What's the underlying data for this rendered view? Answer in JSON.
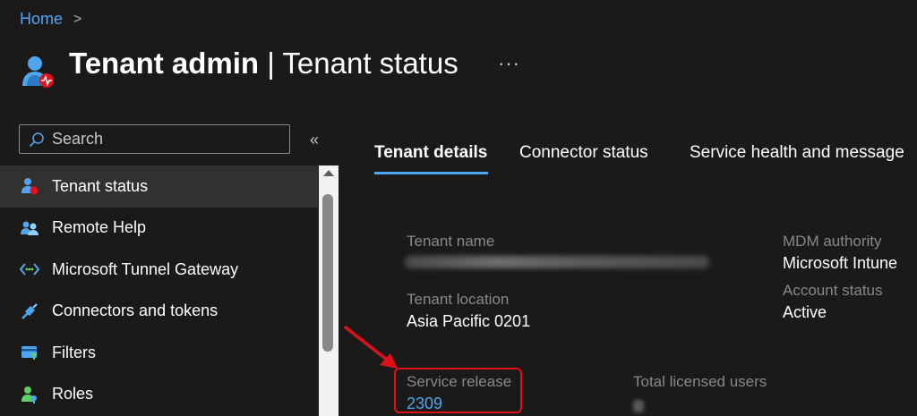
{
  "breadcrumb": {
    "home": "Home",
    "separator": ">"
  },
  "header": {
    "title_strong": "Tenant admin",
    "title_sep": " | ",
    "title_rest": "Tenant status",
    "more": "···",
    "icon": "tenant-admin-icon"
  },
  "search": {
    "placeholder": "Search",
    "value": ""
  },
  "collapse": "«",
  "sidebar": {
    "items": [
      {
        "label": "Tenant status",
        "icon": "tenant-status-icon",
        "active": true
      },
      {
        "label": "Remote Help",
        "icon": "remote-help-icon"
      },
      {
        "label": "Microsoft Tunnel Gateway",
        "icon": "tunnel-gateway-icon"
      },
      {
        "label": "Connectors and tokens",
        "icon": "connectors-icon"
      },
      {
        "label": "Filters",
        "icon": "filters-icon"
      },
      {
        "label": "Roles",
        "icon": "roles-icon"
      }
    ]
  },
  "tabs": [
    {
      "label": "Tenant details",
      "active": true
    },
    {
      "label": "Connector status"
    },
    {
      "label": "Service health and message"
    }
  ],
  "details": {
    "tenant_name_label": "Tenant name",
    "tenant_location_label": "Tenant location",
    "tenant_location_value": "Asia Pacific 0201",
    "service_release_label": "Service release",
    "service_release_value": "2309",
    "total_users_label": "Total licensed users",
    "mdm_authority_label": "MDM authority",
    "mdm_authority_value": "Microsoft Intune",
    "account_status_label": "Account status",
    "account_status_value": "Active"
  },
  "colors": {
    "background": "#1b1a19",
    "accent": "#4ea6f2",
    "highlight": "#e0101b"
  }
}
